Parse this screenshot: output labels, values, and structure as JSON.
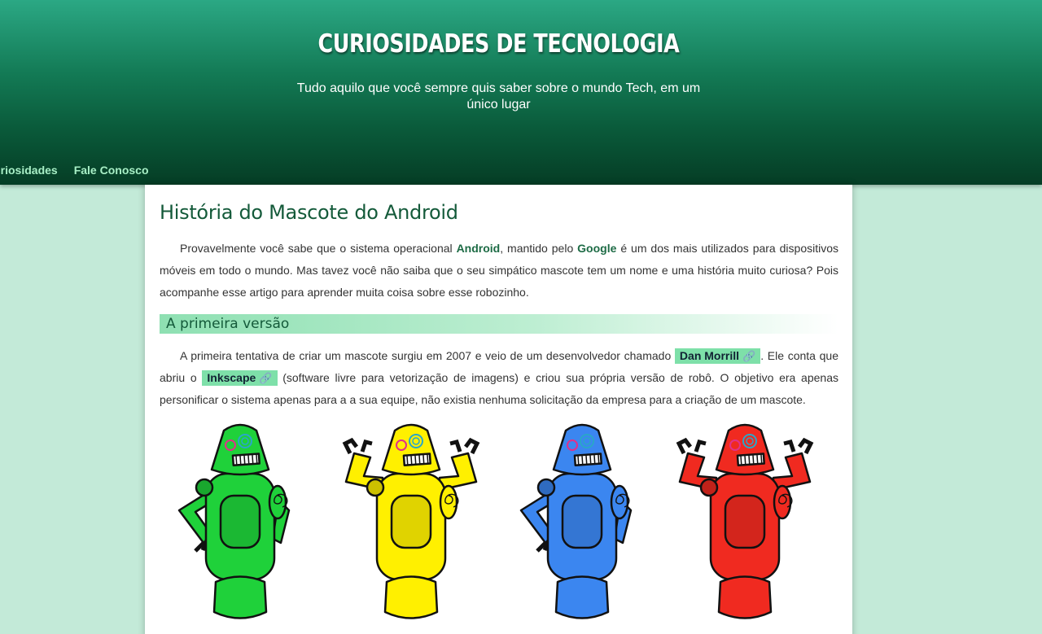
{
  "header": {
    "title": "CURIOSIDADES DE TECNOLOGIA",
    "subtitle": "Tudo aquilo que você sempre quis saber sobre o mundo Tech, em um único lugar"
  },
  "nav": {
    "items": [
      {
        "label": "Curiosidades"
      },
      {
        "label": "Fale Conosco"
      }
    ]
  },
  "article": {
    "title": "História do Mascote do Android",
    "intro": {
      "t1": "Provavelmente você sabe que o sistema operacional ",
      "android": "Android",
      "t2": ", mantido pelo ",
      "google": "Google",
      "t3": " é um dos mais utilizados para dispositivos móveis em todo o mundo. Mas tavez você não saiba que o seu simpático mascote tem um nome e uma história muito curiosa? Pois acompanhe esse artigo para aprender muita coisa sobre esse robozinho."
    },
    "section_title": "A primeira versão",
    "section_p": {
      "t1": "A primeira tentativa de criar um mascote surgiu em 2007 e veio de um desenvolvedor chamado ",
      "link1": "Dan Morrill",
      "t2": ". Ele conta que abriu o ",
      "link2": "Inkscape",
      "t3": " (software livre para vetorização de imagens) e criou sua própria versão de robô. O objetivo era apenas personificar o sistema apenas para a a sua equipe, não existia nenhuma solicitação da empresa para a criação de um mascote."
    },
    "link_icon": "paperclip-icon",
    "robot_colors": [
      "#1fd13a",
      "#fff000",
      "#3b86f0",
      "#f02a20"
    ]
  }
}
